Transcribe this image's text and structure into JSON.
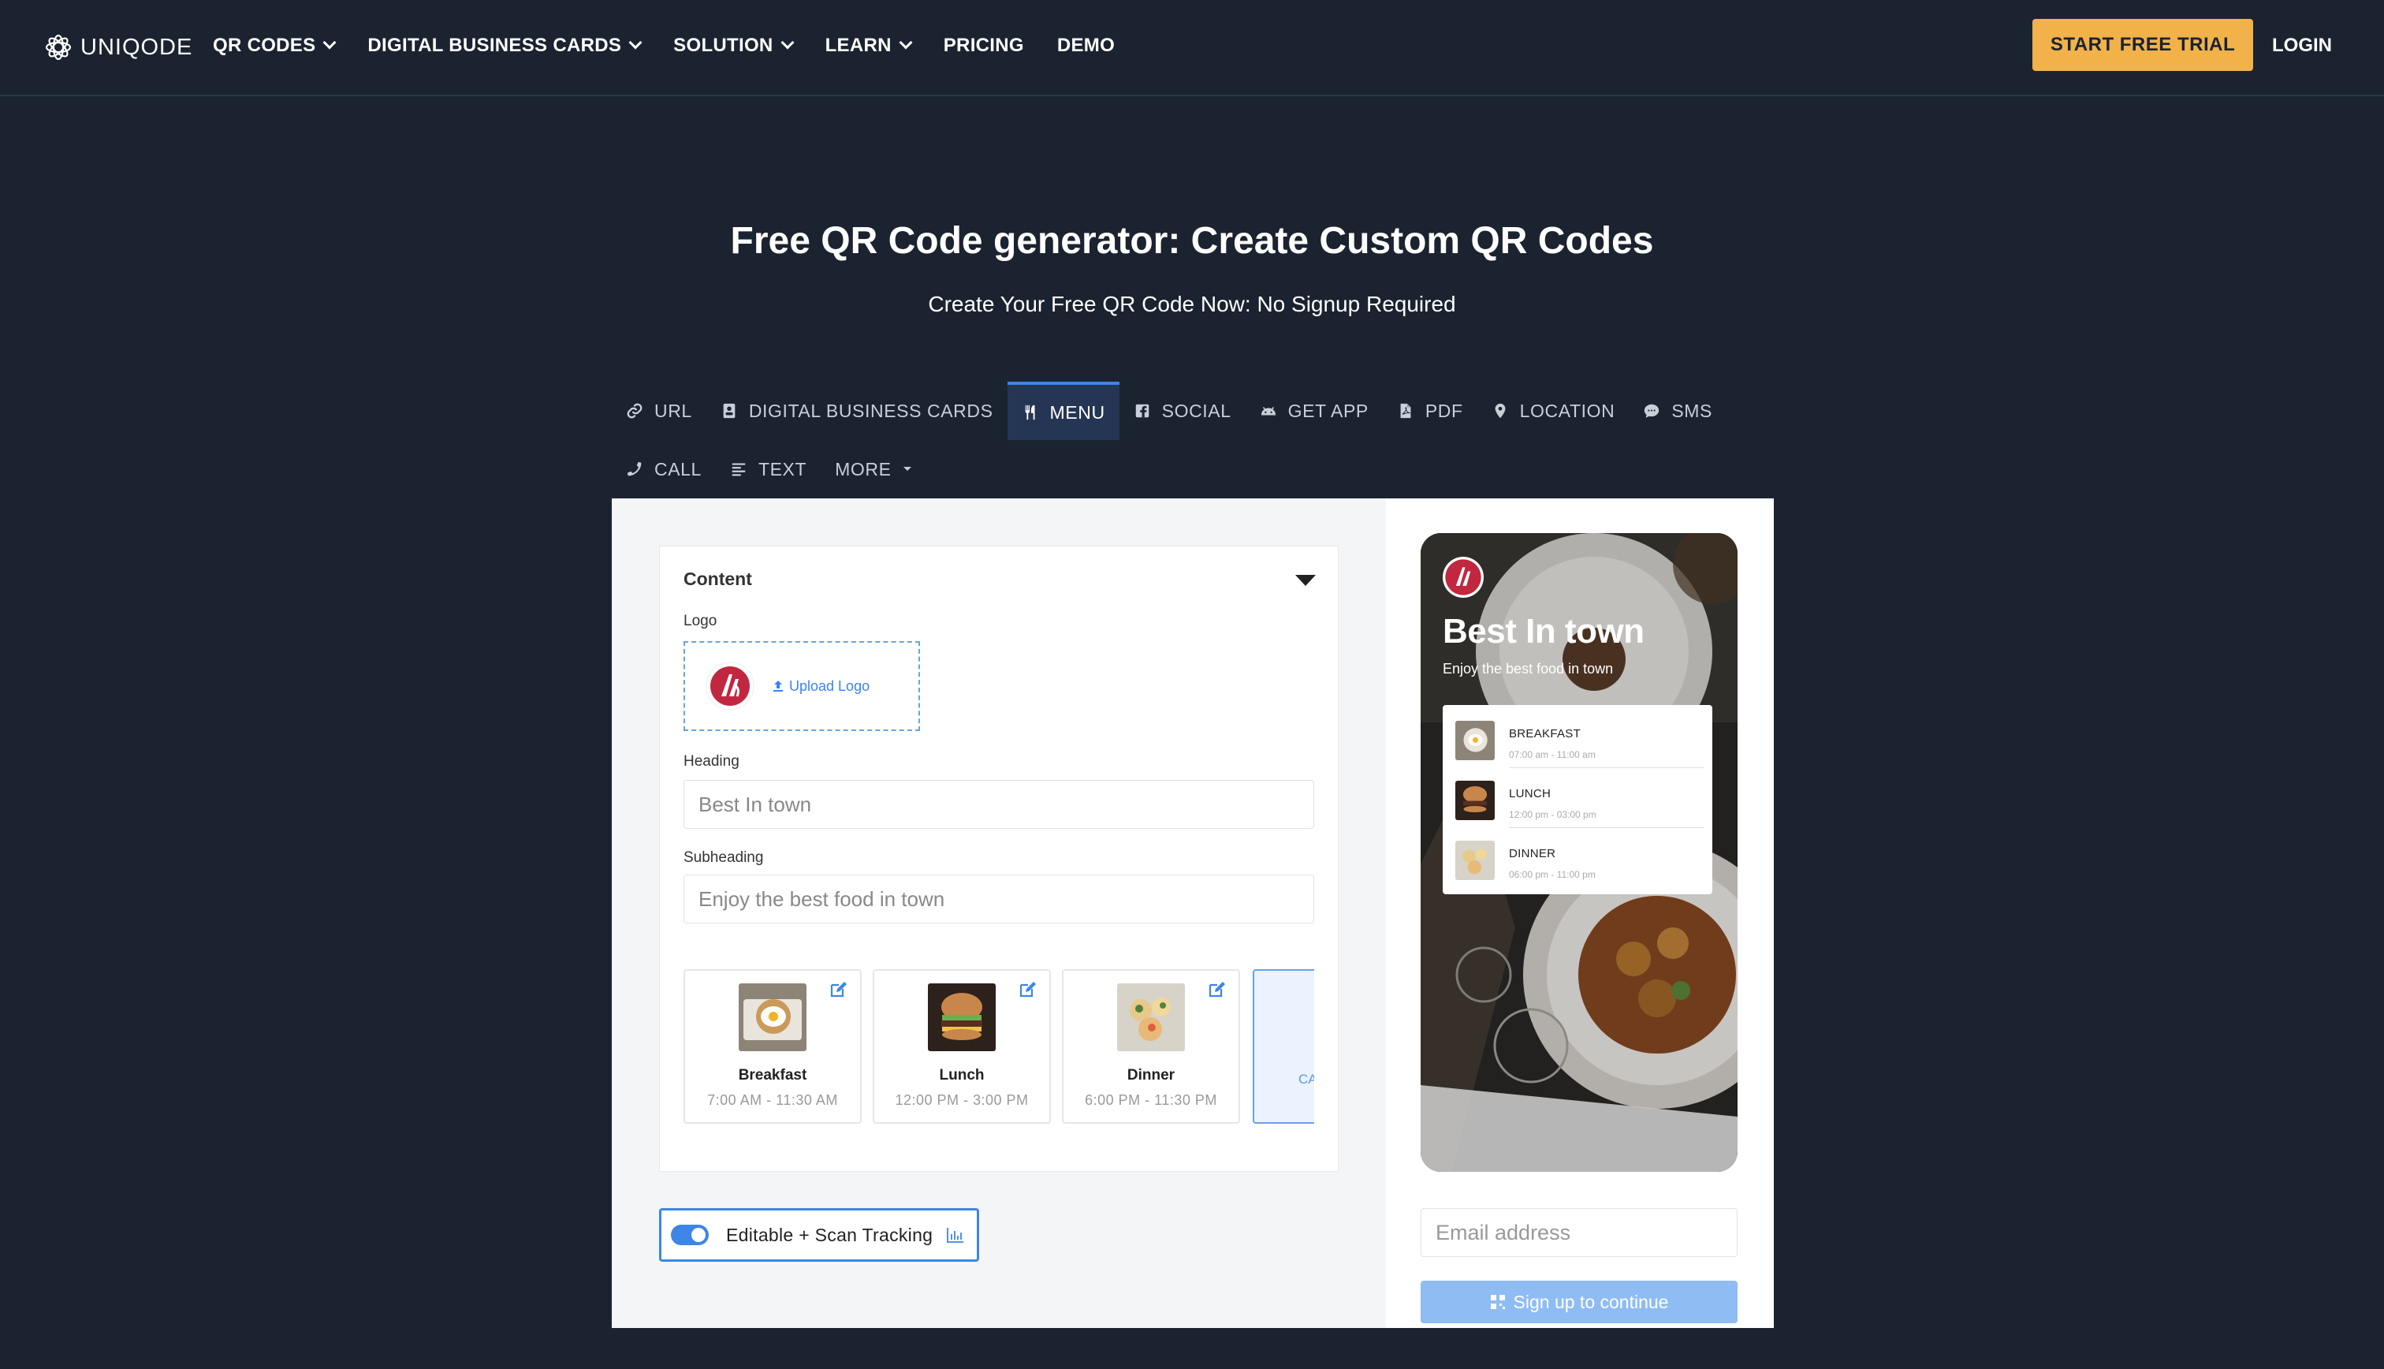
{
  "nav": {
    "logo_text": "UNIQODE",
    "items": [
      {
        "label": "QR CODES",
        "dropdown": true
      },
      {
        "label": "DIGITAL BUSINESS CARDS",
        "dropdown": true
      },
      {
        "label": "SOLUTION",
        "dropdown": true
      },
      {
        "label": "LEARN",
        "dropdown": true
      },
      {
        "label": "PRICING",
        "dropdown": false
      },
      {
        "label": "DEMO",
        "dropdown": false
      }
    ],
    "trial_button": "START FREE TRIAL",
    "login": "LOGIN"
  },
  "hero": {
    "title": "Free QR Code generator: Create Custom QR Codes",
    "subtitle": "Create Your Free QR Code Now: No Signup Required"
  },
  "tabs": {
    "row1": [
      {
        "label": "URL",
        "icon": "link-icon"
      },
      {
        "label": "DIGITAL BUSINESS CARDS",
        "icon": "id-card-icon"
      },
      {
        "label": "MENU",
        "icon": "utensils-icon",
        "active": true
      },
      {
        "label": "SOCIAL",
        "icon": "facebook-icon"
      },
      {
        "label": "GET APP",
        "icon": "android-icon"
      },
      {
        "label": "PDF",
        "icon": "pdf-file-icon"
      },
      {
        "label": "LOCATION",
        "icon": "map-pin-icon"
      },
      {
        "label": "SMS",
        "icon": "chat-bubble-icon"
      }
    ],
    "row2": [
      {
        "label": "CALL",
        "icon": "phone-icon"
      },
      {
        "label": "TEXT",
        "icon": "text-align-icon"
      },
      {
        "label": "MORE",
        "icon": "caret-down-icon"
      }
    ]
  },
  "form": {
    "section_title": "Content",
    "logo_label": "Logo",
    "upload_text": "Upload Logo",
    "heading_label": "Heading",
    "heading_value": "Best In town",
    "subheading_label": "Subheading",
    "subheading_value": "Enjoy the best food in town",
    "meals": [
      {
        "name": "Breakfast",
        "time": "7:00 AM - 11:30 AM"
      },
      {
        "name": "Lunch",
        "time": "12:00 PM - 3:00 PM"
      },
      {
        "name": "Dinner",
        "time": "6:00 PM - 11:30 PM"
      }
    ],
    "add_card_text": "CA",
    "toggle_label": "Editable + Scan Tracking",
    "toggle_on": true
  },
  "preview": {
    "heading": "Best In town",
    "subheading": "Enjoy the best food in town",
    "items": [
      {
        "name": "BREAKFAST",
        "time": "07:00 am - 11:00 am"
      },
      {
        "name": "LUNCH",
        "time": "12:00 pm - 03:00 pm"
      },
      {
        "name": "DINNER",
        "time": "06:00 pm - 11:00 pm"
      }
    ]
  },
  "signup": {
    "email_placeholder": "Email address",
    "button": "Sign up to continue"
  },
  "colors": {
    "background": "#1b2330",
    "accent": "#3d86e6",
    "trial": "#f1b24a",
    "brand_red": "#c1273f"
  }
}
